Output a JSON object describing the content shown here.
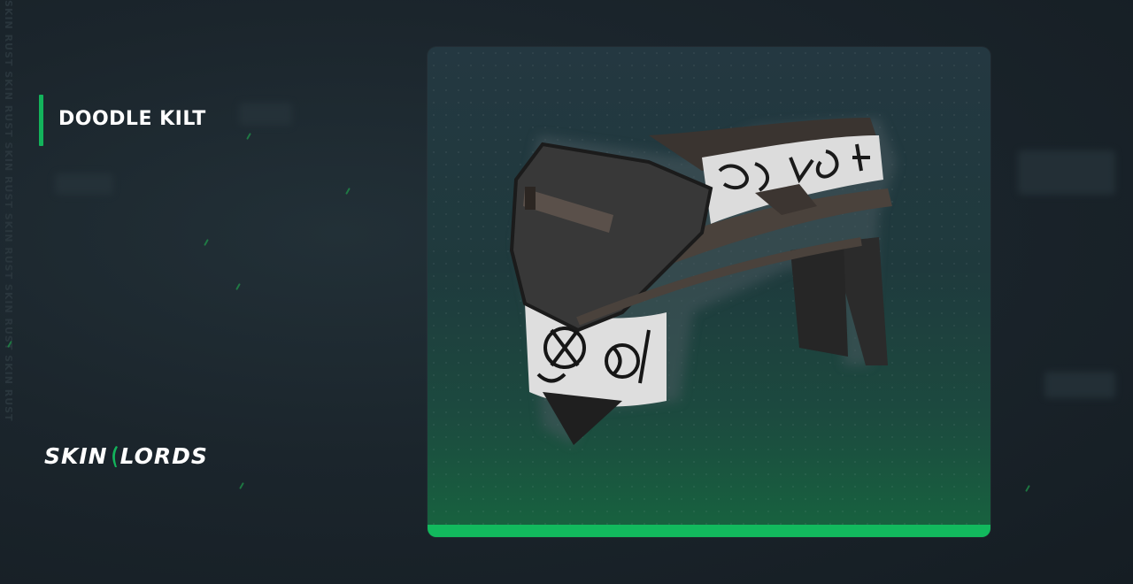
{
  "watermark": "SKIN RUST SKIN RUST SKIN RUST SKIN RUST SKIN RUST SKIN RUST",
  "item": {
    "title": "DOODLE KILT"
  },
  "brand": {
    "left": "SKIN",
    "right": "LORDS"
  },
  "colors": {
    "accent": "#13b35b",
    "background": "#1b252c",
    "card_top": "#243841",
    "card_bottom": "#17643f"
  },
  "icons": {
    "item_image": "doodle-kilt-image",
    "logo_mark": "skinlords-logo-mark"
  }
}
